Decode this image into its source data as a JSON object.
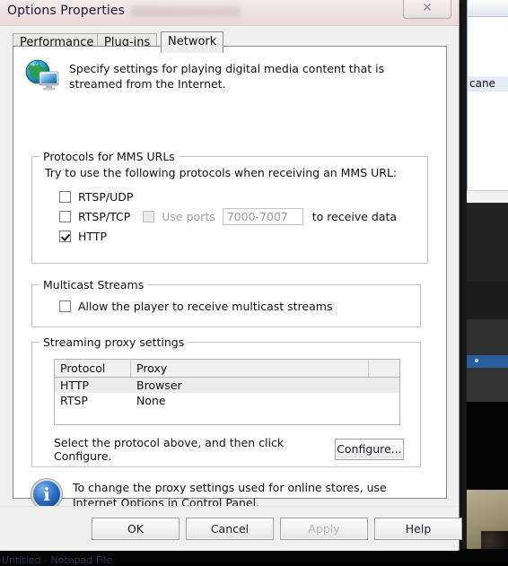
{
  "background": {
    "side_window_text": "cane",
    "taskbar_text": "Untitled - Notepad File"
  },
  "window": {
    "title": "Options Properties",
    "close_label": "✕",
    "close_icon": "close-icon"
  },
  "tabs": [
    {
      "label": "Performance",
      "selected": false
    },
    {
      "label": "Plug-ins",
      "selected": false
    },
    {
      "label": "Network",
      "selected": true
    }
  ],
  "header": {
    "icon": "globe-monitor-icon",
    "text": "Specify settings for playing digital media content that is streamed from the Internet."
  },
  "protocols_group": {
    "title": "Protocols for MMS URLs",
    "instruction": "Try to use the following protocols when receiving an MMS URL:",
    "items": [
      {
        "label": "RTSP/UDP",
        "checked": false,
        "disabled": false
      },
      {
        "label": "RTSP/TCP",
        "checked": false,
        "disabled": false
      },
      {
        "label": "HTTP",
        "checked": true,
        "disabled": false
      }
    ],
    "use_ports": {
      "label": "Use ports",
      "checked": false,
      "disabled": true,
      "value": "7000-7007",
      "suffix": "to receive data"
    }
  },
  "multicast_group": {
    "title": "Multicast Streams",
    "checkbox": {
      "label": "Allow the player to receive multicast streams",
      "checked": false
    }
  },
  "proxy_group": {
    "title": "Streaming proxy settings",
    "columns": [
      "Protocol",
      "Proxy",
      ""
    ],
    "rows": [
      {
        "protocol": "HTTP",
        "proxy": "Browser",
        "selected": true
      },
      {
        "protocol": "RTSP",
        "proxy": "None",
        "selected": false
      }
    ],
    "hint": "Select the protocol above, and then click Configure.",
    "configure_label": "Configure..."
  },
  "info": {
    "icon": "info-icon",
    "text": "To change the proxy settings used for online stores, use Internet Options in Control Panel."
  },
  "footer": {
    "ok": "OK",
    "cancel": "Cancel",
    "apply": "Apply",
    "help": "Help"
  },
  "colors": {
    "dialog_bg": "#f0f0f0",
    "panel_bg": "#ffffff",
    "selected_row": "#ececec",
    "accent_blue": "#2f72c9",
    "disabled_text": "#a0a0a0"
  }
}
